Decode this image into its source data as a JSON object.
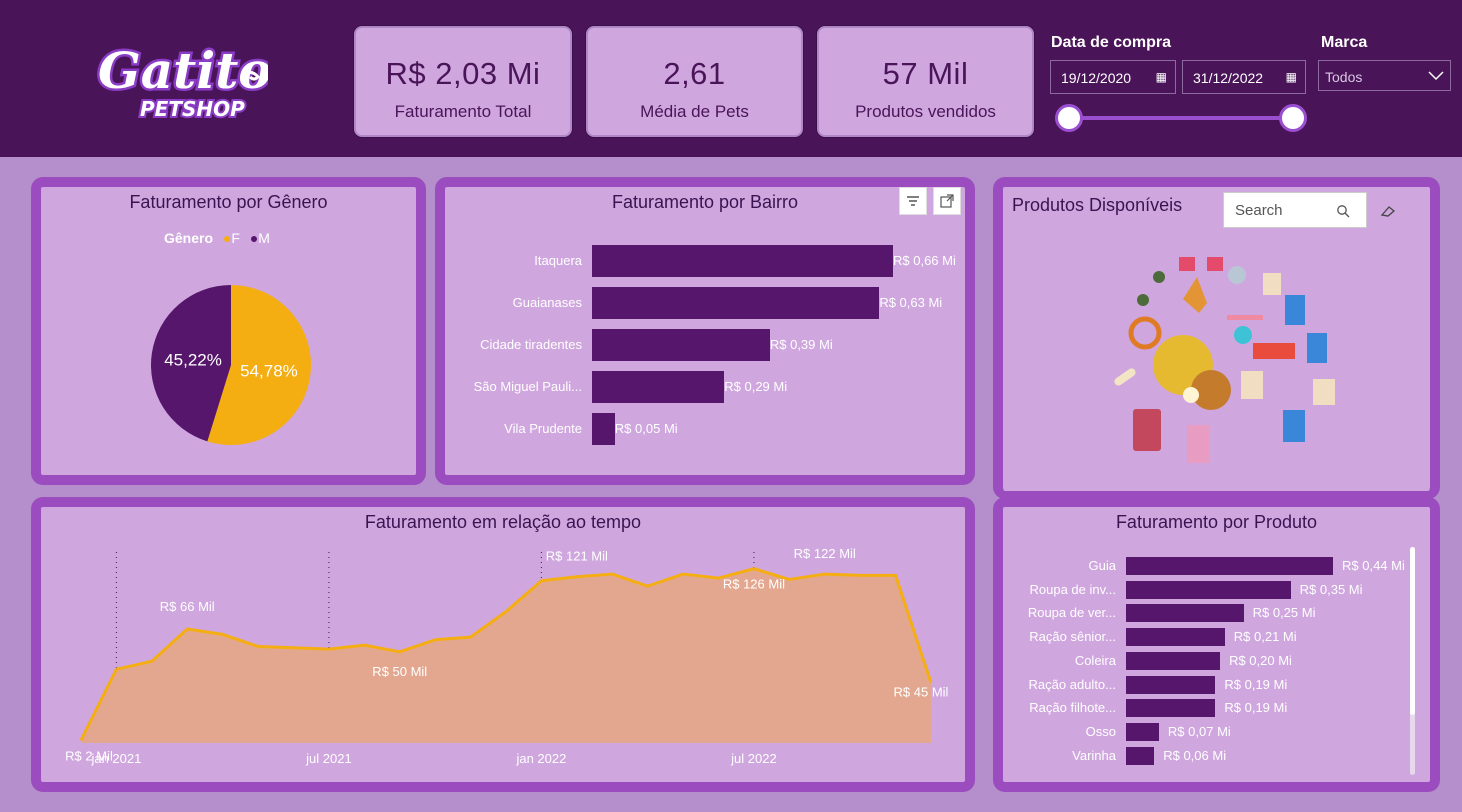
{
  "brand": {
    "logo_main": "Gatito",
    "logo_sub": "PETSHOP"
  },
  "kpis": [
    {
      "value": "R$ 2,03 Mi",
      "label": "Faturamento Total"
    },
    {
      "value": "2,61",
      "label": "Média de Pets"
    },
    {
      "value": "57 Mil",
      "label": "Produtos vendidos"
    }
  ],
  "filters": {
    "date_title": "Data de compra",
    "date_start": "19/12/2020",
    "date_end": "31/12/2022",
    "brand_title": "Marca",
    "brand_value": "Todos",
    "slider_start_fraction": 0,
    "slider_end_fraction": 1
  },
  "gender_panel": {
    "title": "Faturamento por Gênero",
    "legend_title": "Gênero",
    "legend_f": "F",
    "legend_m": "M",
    "colors": {
      "F": "#f5ae12",
      "M": "#55166c"
    }
  },
  "bairro_panel": {
    "title": "Faturamento por Bairro",
    "filter_icon": "filter-icon",
    "focus_icon": "focus-mode-icon"
  },
  "produtos_panel": {
    "title": "Produtos Disponíveis",
    "search_placeholder": "Search",
    "eraser_icon": "eraser-icon"
  },
  "tempo_panel": {
    "title": "Faturamento em relação ao tempo"
  },
  "produto_panel": {
    "title": "Faturamento por Produto"
  },
  "chart_data": [
    {
      "type": "pie",
      "title": "Faturamento por Gênero",
      "legend_title": "Gênero",
      "labels": [
        "F",
        "M"
      ],
      "values": [
        54.78,
        45.22
      ],
      "value_labels": [
        "54,78%",
        "45,22%"
      ],
      "colors": [
        "#f5ae12",
        "#55166c"
      ]
    },
    {
      "type": "bar",
      "orientation": "horizontal",
      "title": "Faturamento por Bairro",
      "categories": [
        "Itaquera",
        "Guaianases",
        "Cidade tiradentes",
        "São Miguel Pauli...",
        "Vila Prudente"
      ],
      "values": [
        0.66,
        0.63,
        0.39,
        0.29,
        0.05
      ],
      "value_labels": [
        "R$ 0,66 Mi",
        "R$ 0,63 Mi",
        "R$ 0,39 Mi",
        "R$ 0,29 Mi",
        "R$ 0,05 Mi"
      ],
      "unit": "R$ Mi",
      "color": "#55166c"
    },
    {
      "type": "area",
      "title": "Faturamento em relação ao tempo",
      "x": [
        "2020-12",
        "2021-01",
        "2021-02",
        "2021-03",
        "2021-04",
        "2021-05",
        "2021-06",
        "2021-07",
        "2021-08",
        "2021-09",
        "2021-10",
        "2021-11",
        "2021-12",
        "2022-01",
        "2022-02",
        "2022-03",
        "2022-04",
        "2022-05",
        "2022-06",
        "2022-07",
        "2022-08",
        "2022-09",
        "2022-10",
        "2022-11",
        "2022-12"
      ],
      "values": [
        2,
        55,
        61,
        85,
        81,
        72,
        71,
        70,
        73,
        68,
        77,
        79,
        98,
        121,
        124,
        126,
        117,
        126,
        123,
        130,
        122,
        126,
        125,
        125,
        45
      ],
      "unit": "R$ Mil",
      "xtick_labels": [
        "jan 2021",
        "jul 2021",
        "jan 2022",
        "jul 2022"
      ],
      "xtick_positions": [
        "2021-01",
        "2021-07",
        "2022-01",
        "2022-07"
      ],
      "annotations": [
        {
          "x": "2020-12",
          "label": "R$ 2 Mil"
        },
        {
          "x": "2021-03",
          "label": "R$ 66 Mil"
        },
        {
          "x": "2021-09",
          "label": "R$ 50 Mil"
        },
        {
          "x": "2022-02",
          "label": "R$ 121 Mil"
        },
        {
          "x": "2022-07",
          "label": "R$ 126 Mil"
        },
        {
          "x": "2022-09",
          "label": "R$ 122 Mil"
        },
        {
          "x": "2022-12",
          "label": "R$ 45 Mil"
        }
      ],
      "line_color": "#f5ae12",
      "fill_color": "#e3a78f"
    },
    {
      "type": "bar",
      "orientation": "horizontal",
      "title": "Faturamento por Produto",
      "categories": [
        "Guia",
        "Roupa de inv...",
        "Roupa de ver...",
        "Ração sênior...",
        "Coleira",
        "Ração adulto...",
        "Ração filhote...",
        "Osso",
        "Varinha"
      ],
      "values": [
        0.44,
        0.35,
        0.25,
        0.21,
        0.2,
        0.19,
        0.19,
        0.07,
        0.06
      ],
      "value_labels": [
        "R$ 0,44 Mi",
        "R$ 0,35 Mi",
        "R$ 0,25 Mi",
        "R$ 0,21 Mi",
        "R$ 0,20 Mi",
        "R$ 0,19 Mi",
        "R$ 0,19 Mi",
        "R$ 0,07 Mi",
        "R$ 0,06 Mi"
      ],
      "unit": "R$ Mi",
      "color": "#55166c"
    }
  ]
}
